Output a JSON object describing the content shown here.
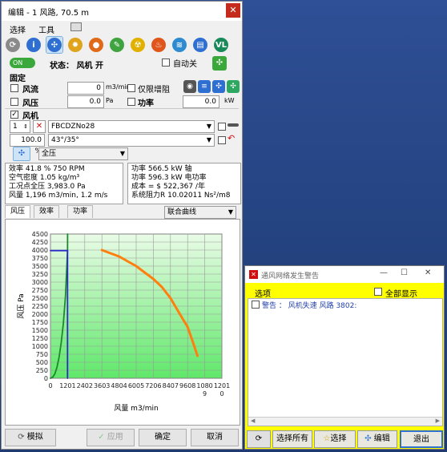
{
  "dialog": {
    "title": "编辑 - 1 风路, 70.5 m",
    "close_glyph": "✕",
    "menu": {
      "select": "选择",
      "tools": "工具"
    },
    "toolbar_icons": [
      {
        "name": "refresh-icon",
        "glyph": "⟳",
        "color": "#8a8a8a"
      },
      {
        "name": "info-icon",
        "glyph": "i",
        "color": "#2e6fd1"
      },
      {
        "name": "fan-icon",
        "glyph": "✣",
        "color": "#2e6fd1"
      },
      {
        "name": "sun-icon",
        "glyph": "✹",
        "color": "#e0a41c"
      },
      {
        "name": "fire-badge-icon",
        "glyph": "●",
        "color": "#e06a1a"
      },
      {
        "name": "chat-icon",
        "glyph": "✎",
        "color": "#3fa33f"
      },
      {
        "name": "radiation-icon",
        "glyph": "☢",
        "color": "#e2b100"
      },
      {
        "name": "flame-icon",
        "glyph": "♨",
        "color": "#e0561a"
      },
      {
        "name": "wifi-icon",
        "glyph": "≋",
        "color": "#2e8bd1"
      },
      {
        "name": "layers-icon",
        "glyph": "▤",
        "color": "#2e6fd1"
      },
      {
        "name": "vl-icon",
        "glyph": "VL",
        "color": "#188a5a"
      }
    ],
    "status": {
      "toggle": "ON",
      "label": "状态： 风机 开",
      "auto_label": "自动关"
    },
    "fixed": {
      "heading": "固定",
      "airflow_label": "风流",
      "airflow_value": "0",
      "airflow_unit": "m3/min",
      "increase_only_label": "仅限增阻",
      "pressure_label": "风压",
      "pressure_value": "0.0",
      "pressure_unit": "Pa",
      "power_label": "功率",
      "power_value": "0.0",
      "power_unit": "kW"
    },
    "fan": {
      "heading": "风机",
      "count": "1",
      "model": "FBCDZNo28",
      "speed_pct": "100.0 %",
      "angle": "43°/35°",
      "pressure_type": "全压"
    },
    "info_left": [
      "效率 41.8 %  750 RPM",
      "空气密度 1.05 kg/m³",
      "工况点全压 3,983.0 Pa",
      "风量 1,196 m3/min, 1.2 m/s"
    ],
    "info_right": [
      "功率 566.5 kW 轴",
      "功率 596.3 kW 电功率",
      "成本 = $ 522,367 /年",
      "系统阻力R 10.02011 Ns²/m8"
    ],
    "tabs": [
      "风压",
      "效率",
      "功率"
    ],
    "curve_select": "联合曲线",
    "buttons": {
      "simulate": "模拟",
      "apply": "应用",
      "ok": "确定",
      "cancel": "取消"
    }
  },
  "chart_data": {
    "type": "line",
    "xlabel": "风量 m3/min",
    "ylabel": "风压 Pa",
    "x_ticks": [
      "0",
      "1201",
      "2402",
      "3603",
      "4804",
      "6005",
      "7206",
      "8407",
      "9608",
      "1080\n9",
      "1201\n0"
    ],
    "y_ticks": [
      0,
      250,
      500,
      750,
      1000,
      1250,
      1500,
      1750,
      2000,
      2250,
      2500,
      2750,
      3000,
      3250,
      3500,
      3750,
      4000,
      4250,
      4500
    ],
    "xlim": [
      0,
      12010
    ],
    "ylim": [
      0,
      4500
    ],
    "grid": true,
    "background": "gradient-green",
    "series": [
      {
        "color": "#ff7f0e",
        "x": [
          3603,
          4200,
          4804,
          5400,
          6005,
          6600,
          7206,
          7800,
          8407,
          9000,
          9608,
          10000,
          10300
        ],
        "y": [
          4000,
          3900,
          3800,
          3650,
          3500,
          3300,
          3100,
          2850,
          2500,
          2050,
          1600,
          1100,
          700
        ]
      },
      {
        "color": "#1a8a2a",
        "x": [
          0,
          150,
          300,
          450,
          600,
          750,
          900,
          1050,
          1196,
          1201
        ],
        "y": [
          0,
          30,
          130,
          330,
          650,
          1100,
          1700,
          2550,
          3983,
          4500
        ]
      },
      {
        "color": "#2a2ac8",
        "x": [
          0,
          1196,
          1196
        ],
        "y": [
          3983,
          3983,
          0
        ]
      }
    ]
  },
  "warning": {
    "title": "通风网络发生警告",
    "col_header": "选项",
    "show_all": "全部显示",
    "item_text": "警告 ：  风机失速  风路  3802:",
    "buttons": {
      "select_all": "选择所有",
      "select": "选择",
      "edit": "编辑",
      "exit": "退出"
    }
  }
}
